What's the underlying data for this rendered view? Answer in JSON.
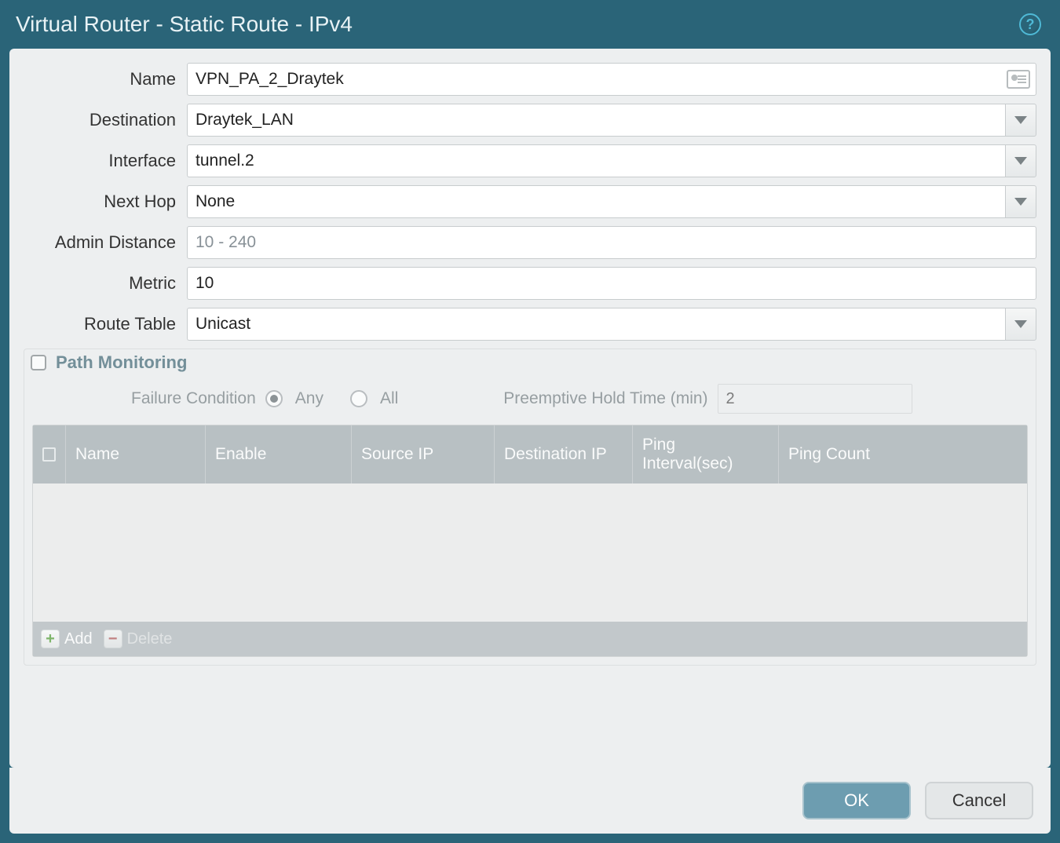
{
  "title": "Virtual Router - Static Route - IPv4",
  "form": {
    "name_label": "Name",
    "name_value": "VPN_PA_2_Draytek",
    "destination_label": "Destination",
    "destination_value": "Draytek_LAN",
    "interface_label": "Interface",
    "interface_value": "tunnel.2",
    "nexthop_label": "Next Hop",
    "nexthop_value": "None",
    "admindist_label": "Admin Distance",
    "admindist_placeholder": "10 - 240",
    "admindist_value": "",
    "metric_label": "Metric",
    "metric_value": "10",
    "routetable_label": "Route Table",
    "routetable_value": "Unicast"
  },
  "path_monitoring": {
    "legend": "Path Monitoring",
    "enabled": false,
    "failure_condition_label": "Failure Condition",
    "option_any": "Any",
    "option_all": "All",
    "selected": "Any",
    "preemptive_label": "Preemptive Hold Time (min)",
    "preemptive_value": "2",
    "columns": {
      "name": "Name",
      "enable": "Enable",
      "source_ip": "Source IP",
      "destination_ip": "Destination IP",
      "ping_interval": "Ping Interval(sec)",
      "ping_count": "Ping Count"
    },
    "rows": [],
    "add_label": "Add",
    "delete_label": "Delete"
  },
  "buttons": {
    "ok": "OK",
    "cancel": "Cancel"
  }
}
